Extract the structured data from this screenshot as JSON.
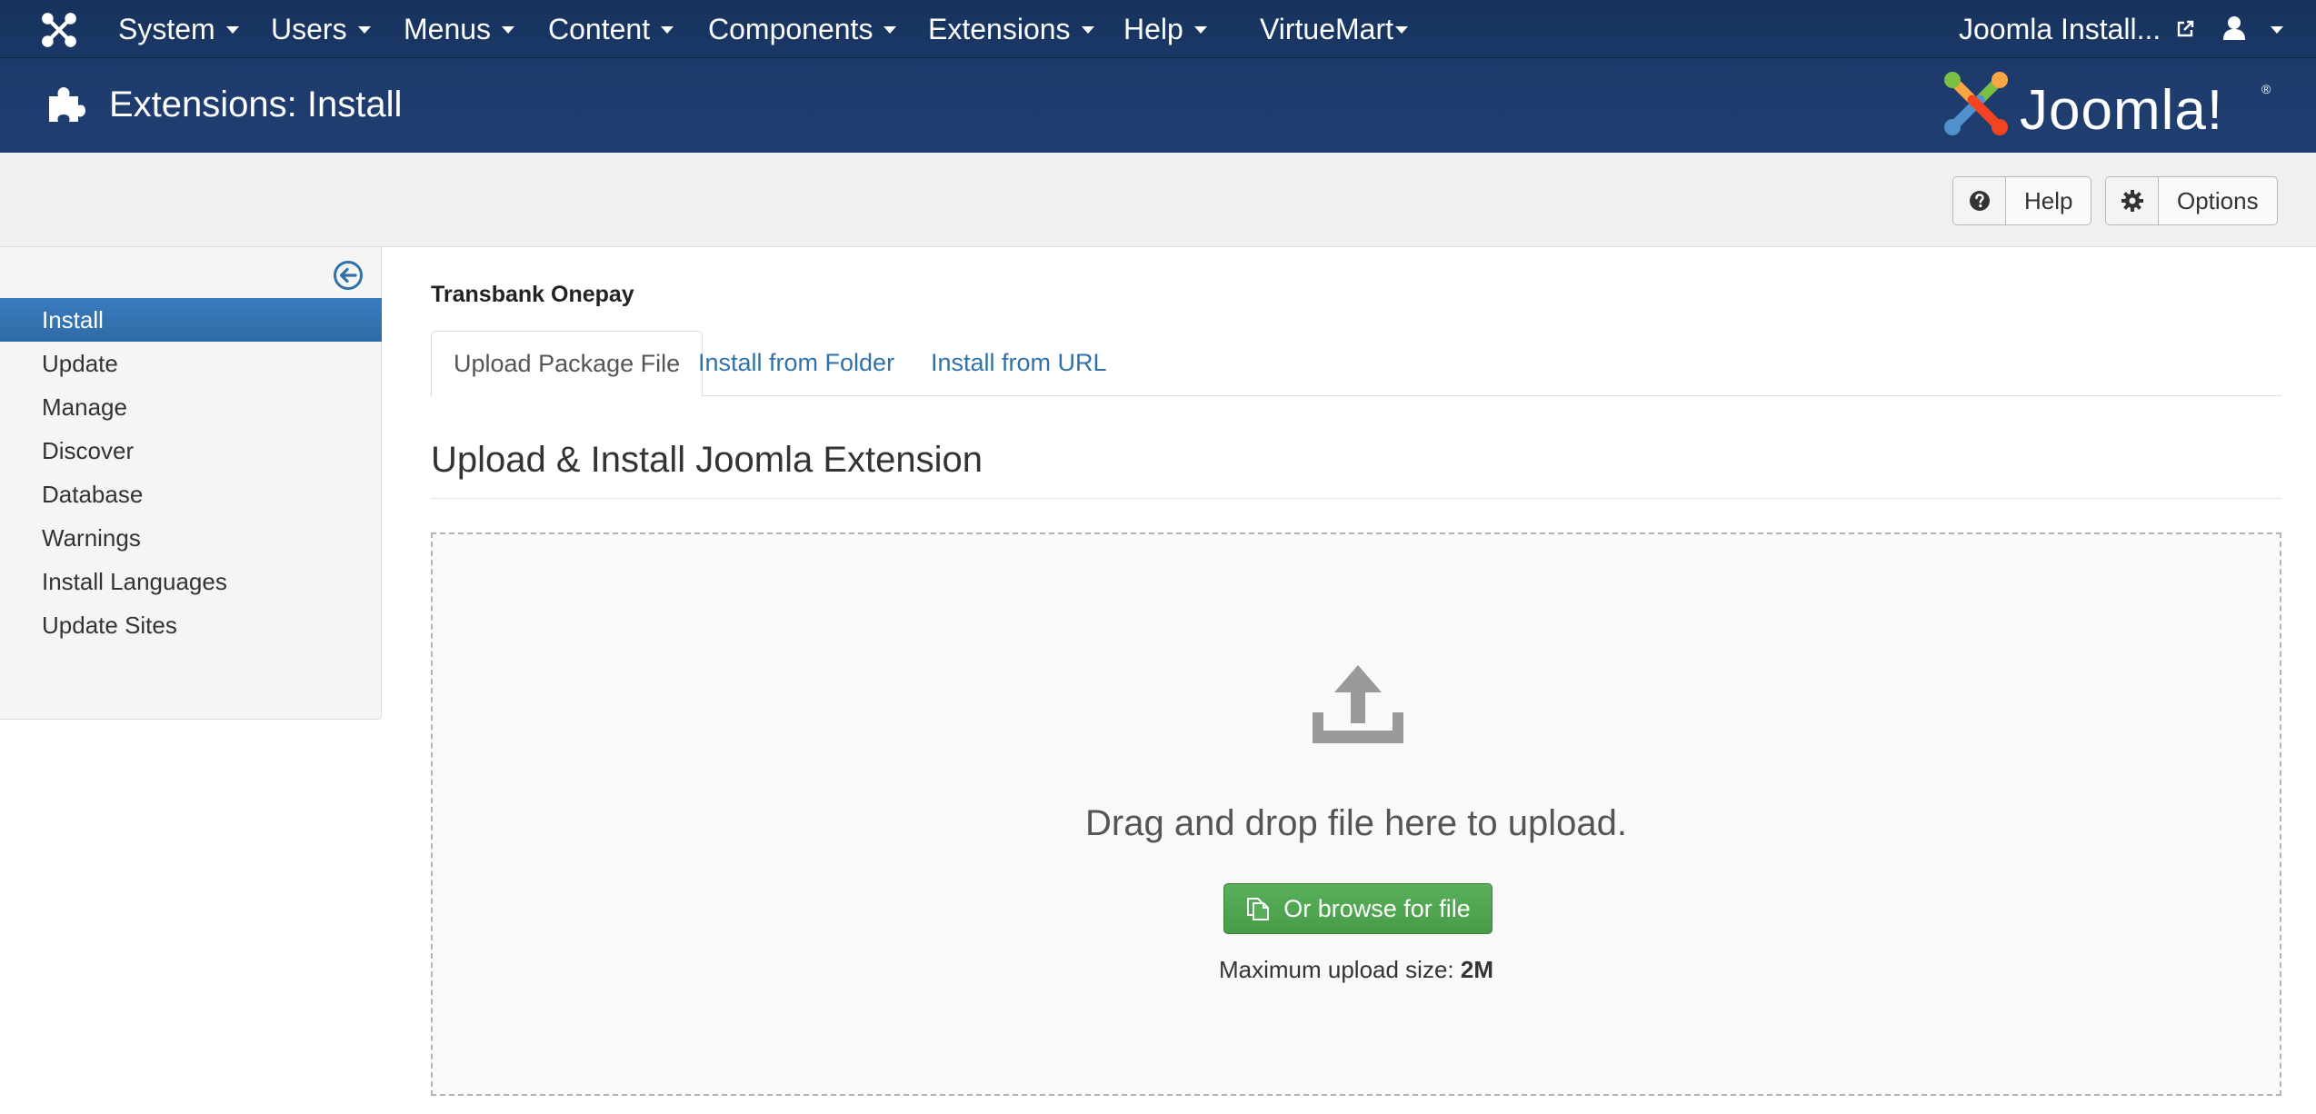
{
  "topnav": {
    "menus": [
      {
        "label": "System"
      },
      {
        "label": "Users"
      },
      {
        "label": "Menus"
      },
      {
        "label": "Content"
      },
      {
        "label": "Components"
      },
      {
        "label": "Extensions"
      },
      {
        "label": "Help"
      },
      {
        "label": "VirtueMart"
      }
    ],
    "site_link": "Joomla Install..."
  },
  "header": {
    "title": "Extensions: Install",
    "brand": "Joomla!"
  },
  "toolbar": {
    "help_label": "Help",
    "options_label": "Options"
  },
  "sidebar": {
    "items": [
      {
        "label": "Install",
        "active": true
      },
      {
        "label": "Update"
      },
      {
        "label": "Manage"
      },
      {
        "label": "Discover"
      },
      {
        "label": "Database"
      },
      {
        "label": "Warnings"
      },
      {
        "label": "Install Languages"
      },
      {
        "label": "Update Sites"
      }
    ]
  },
  "main": {
    "extension_name": "Transbank Onepay",
    "tabs": [
      {
        "label": "Upload Package File",
        "active": true
      },
      {
        "label": "Install from Folder"
      },
      {
        "label": "Install from URL"
      }
    ],
    "section_title": "Upload & Install Joomla Extension",
    "dropzone": {
      "drop_text": "Drag and drop file here to upload.",
      "browse_label": "Or browse for file",
      "max_label": "Maximum upload size:",
      "max_value": "2M"
    }
  },
  "colors": {
    "navbar": "#17325c",
    "titlebar": "#1f3d6e",
    "active_sidebar": "#3071a9",
    "link": "#3071a9",
    "success_button": "#51a351"
  },
  "icons": [
    "joomla-icon",
    "external-link-icon",
    "user-icon",
    "puzzle-icon",
    "joomla-logo-icon",
    "question-circle-icon",
    "gear-icon",
    "collapse-arrow-icon",
    "upload-icon",
    "copy-file-icon"
  ]
}
